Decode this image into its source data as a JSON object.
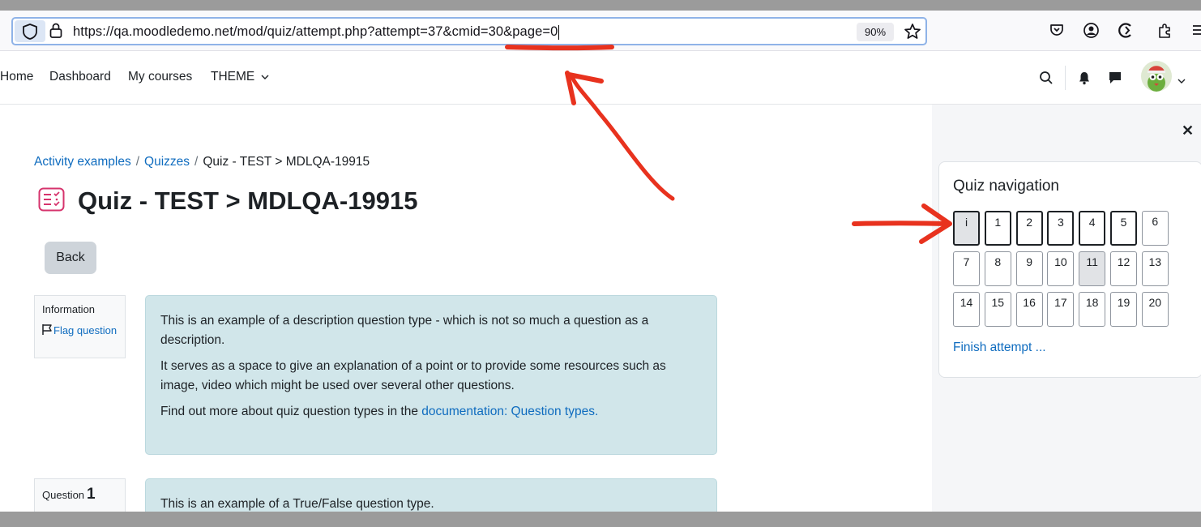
{
  "browser": {
    "url_text": "https://qa.moodledemo.net/mod/quiz/attempt.php?attempt=37&cmid=30&page=0",
    "zoom_label": "90%",
    "icons": [
      "shield-icon",
      "lock-icon",
      "bookmark-star-icon",
      "pocket-icon",
      "account-icon",
      "sync-icon",
      "extensions-icon",
      "menu-icon"
    ]
  },
  "nav": {
    "links": [
      "Home",
      "Dashboard",
      "My courses",
      "THEME"
    ],
    "icons": [
      "search-icon",
      "bell-icon",
      "chat-icon",
      "avatar",
      "chevron-down-icon"
    ]
  },
  "breadcrumb": {
    "items": [
      "Activity examples",
      "Quizzes",
      "Quiz - TEST > MDLQA-19915"
    ],
    "separator": "/"
  },
  "page": {
    "title": "Quiz - TEST > MDLQA-19915",
    "back_label": "Back"
  },
  "info_block": {
    "title": "Information",
    "flag_label": "Flag question"
  },
  "question_block": {
    "label": "Question",
    "number": "1"
  },
  "description": {
    "p1": "This is an example of a description question type - which is not so much a question as a description.",
    "p2": "It serves as a space to give an explanation of a point or to provide some resources such as image, video which might be used over several other questions.",
    "p3_prefix": "Find out more about quiz question types in the ",
    "p3_link": "documentation: Question types."
  },
  "question1": {
    "text": "This is an example of a True/False question type."
  },
  "quiz_nav": {
    "title": "Quiz navigation",
    "buttons": [
      {
        "label": "i",
        "style": "thick-shaded"
      },
      {
        "label": "1",
        "style": "thick"
      },
      {
        "label": "2",
        "style": "thick"
      },
      {
        "label": "3",
        "style": "thick"
      },
      {
        "label": "4",
        "style": "thick"
      },
      {
        "label": "5",
        "style": "thick"
      },
      {
        "label": "6",
        "style": "normal"
      },
      {
        "label": "7",
        "style": "normal"
      },
      {
        "label": "8",
        "style": "normal"
      },
      {
        "label": "9",
        "style": "normal"
      },
      {
        "label": "10",
        "style": "normal"
      },
      {
        "label": "11",
        "style": "shaded"
      },
      {
        "label": "12",
        "style": "normal"
      },
      {
        "label": "13",
        "style": "normal"
      },
      {
        "label": "14",
        "style": "normal"
      },
      {
        "label": "15",
        "style": "normal"
      },
      {
        "label": "16",
        "style": "normal"
      },
      {
        "label": "17",
        "style": "normal"
      },
      {
        "label": "18",
        "style": "normal"
      },
      {
        "label": "19",
        "style": "normal"
      },
      {
        "label": "20",
        "style": "normal"
      }
    ],
    "finish_label": "Finish attempt ..."
  },
  "colors": {
    "link": "#0f6cbf",
    "content_bg": "#d1e6ea",
    "annotation": "#e8321e",
    "drawer_bg": "#f5f6f8"
  }
}
